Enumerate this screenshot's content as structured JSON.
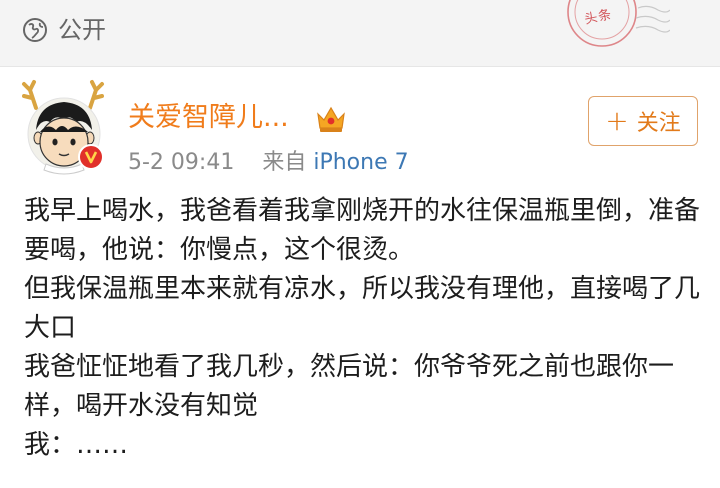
{
  "header": {
    "visibility_icon": "globe-icon",
    "visibility_label": "公开",
    "stamp_icon": "postmark-stamp",
    "stamp_text": "头条"
  },
  "author": {
    "avatar_icon": "cartoon-avatar-with-antlers",
    "verified_icon": "verified-badge",
    "name": "关爱智障儿...",
    "vip_icon": "crown-vip-icon",
    "time": "5-2 09:41",
    "source_prefix": "来自",
    "source": "iPhone 7"
  },
  "follow_button": {
    "label": "关注",
    "icon": "plus-icon"
  },
  "post": {
    "lines": [
      "我早上喝水，我爸看着我拿刚烧开的水往保温瓶里倒，准备要喝，他说：你慢点，这个很烫。",
      "但我保温瓶里本来就有凉水，所以我没有理他，直接喝了几大口",
      "我爸怔怔地看了我几秒，然后说：你爷爷死之前也跟你一样，喝开水没有知觉",
      "我：……"
    ]
  },
  "colors": {
    "username": "#f07c1b",
    "source_link": "#3d78b4",
    "follow_accent": "#e27a1a",
    "verified_badge": "#e1302a"
  }
}
